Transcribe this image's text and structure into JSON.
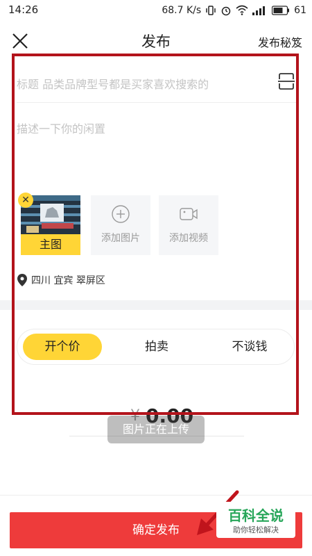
{
  "status_bar": {
    "time": "14:26",
    "net_speed": "68.7 K/s",
    "battery": "61"
  },
  "nav": {
    "title": "发布",
    "tips_label": "发布秘笈"
  },
  "form": {
    "title_placeholder": "标题 品类品牌型号都是买家喜欢搜索的",
    "desc_placeholder": "描述一下你的闲置",
    "main_image_label": "主图",
    "add_photo_label": "添加图片",
    "add_video_label": "添加视频",
    "location": "四川 宜宾 翠屏区"
  },
  "price_tabs": [
    {
      "label": "开个价",
      "active": true
    },
    {
      "label": "拍卖",
      "active": false
    },
    {
      "label": "不谈钱",
      "active": false
    }
  ],
  "price": {
    "currency": "¥",
    "value": "0.00"
  },
  "toast": "图片正在上传",
  "confirm_label": "确定发布",
  "watermark": {
    "title": "百科全说",
    "subtitle": "助你轻松解决"
  },
  "colors": {
    "accent_yellow": "#ffd536",
    "confirm_red": "#ee3b3b",
    "annotation_red": "#b3131b",
    "watermark_green": "#27a659"
  }
}
